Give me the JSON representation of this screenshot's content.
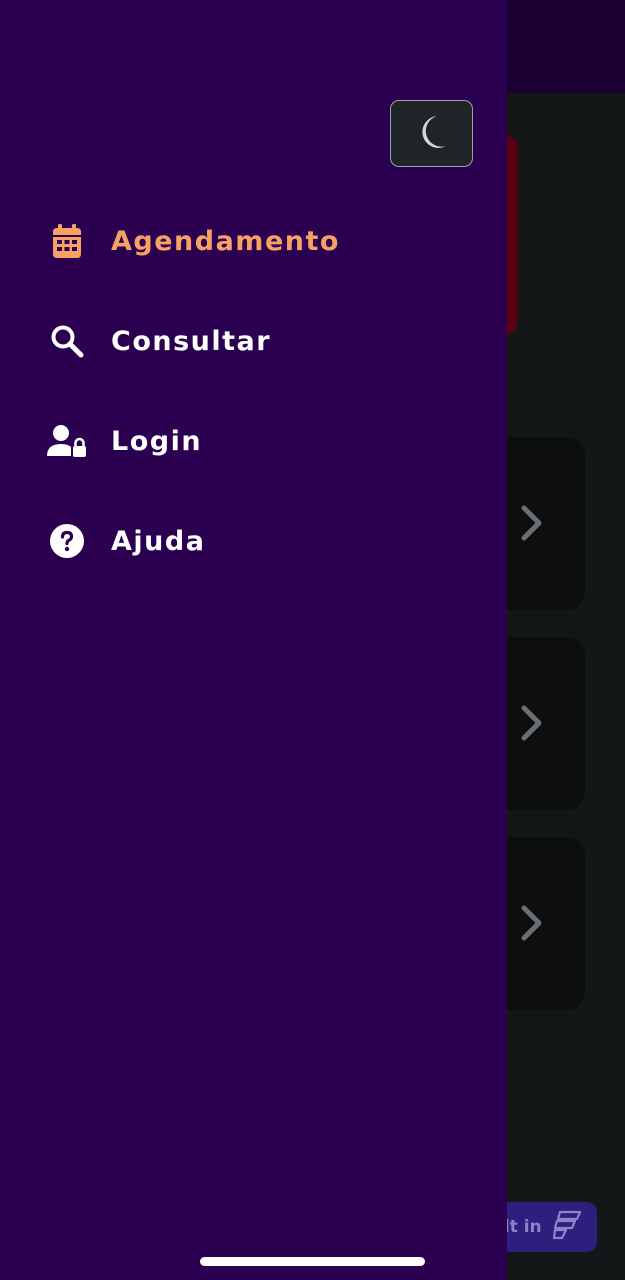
{
  "background": {
    "badge_text": "ilt in",
    "cards": [
      {
        "chevron_icon": "chevron-right-icon"
      },
      {
        "chevron_icon": "chevron-right-icon"
      },
      {
        "chevron_icon": "chevron-right-icon"
      }
    ]
  },
  "drawer": {
    "theme_toggle_icon": "moon-icon",
    "items": [
      {
        "label": "Agendamento",
        "icon": "calendar-icon",
        "active": true
      },
      {
        "label": "Consultar",
        "icon": "search-icon",
        "active": false
      },
      {
        "label": "Login",
        "icon": "user-lock-icon",
        "active": false
      },
      {
        "label": "Ajuda",
        "icon": "help-circle-icon",
        "active": false
      }
    ]
  },
  "colors": {
    "drawer_bg": "#2b0050",
    "active_text": "#f7a264",
    "text": "#ffffff",
    "page_bg": "#131718"
  }
}
